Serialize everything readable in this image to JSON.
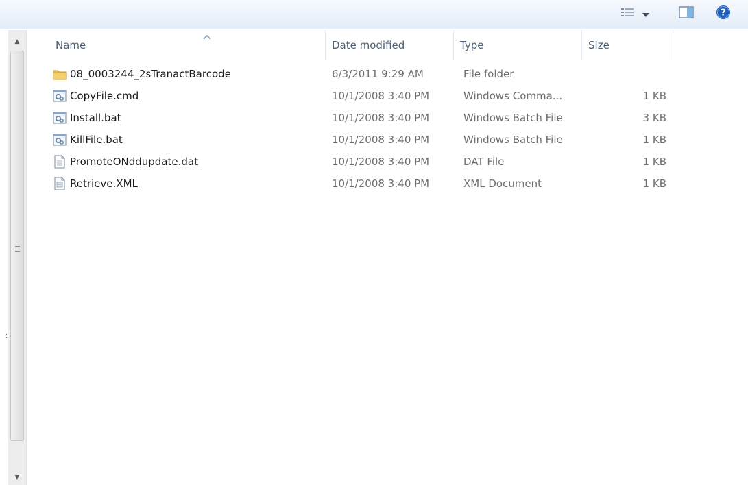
{
  "toolbar": {
    "views_icon": "view-options-icon",
    "preview_icon": "preview-pane-icon",
    "help_icon": "help-icon"
  },
  "columns": {
    "name": "Name",
    "date": "Date modified",
    "type": "Type",
    "size": "Size"
  },
  "files": [
    {
      "icon": "folder-icon",
      "name": "08_0003244_2sTranactBarcode",
      "date": "6/3/2011 9:29 AM",
      "type": "File folder",
      "size": ""
    },
    {
      "icon": "batch-file-icon",
      "name": "CopyFile.cmd",
      "date": "10/1/2008 3:40 PM",
      "type": "Windows Comma...",
      "size": "1 KB"
    },
    {
      "icon": "batch-file-icon",
      "name": "Install.bat",
      "date": "10/1/2008 3:40 PM",
      "type": "Windows Batch File",
      "size": "3 KB"
    },
    {
      "icon": "batch-file-icon",
      "name": "KillFile.bat",
      "date": "10/1/2008 3:40 PM",
      "type": "Windows Batch File",
      "size": "1 KB"
    },
    {
      "icon": "document-file-icon",
      "name": "PromoteONddupdate.dat",
      "date": "10/1/2008 3:40 PM",
      "type": "DAT File",
      "size": "1 KB"
    },
    {
      "icon": "xml-file-icon",
      "name": "Retrieve.XML",
      "date": "10/1/2008 3:40 PM",
      "type": "XML Document",
      "size": "1 KB"
    }
  ],
  "colors": {
    "header_text": "#4a5f78",
    "folder": "#e8b84a",
    "help": "#1f5fbf",
    "toolbar_bg": "#e4ecf7"
  }
}
